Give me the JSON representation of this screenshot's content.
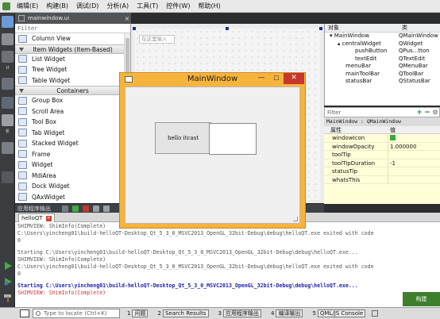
{
  "app": {
    "menu": [
      "编辑(E)",
      "构建(B)",
      "调试(D)",
      "分析(A)",
      "工具(T)",
      "控件(W)",
      "帮助(H)"
    ]
  },
  "modebar": {
    "labels": [
      "计",
      "",
      "",
      "析",
      "",
      "",
      ""
    ]
  },
  "editor_tab": {
    "filename": "mainwindow.ui"
  },
  "widget_box": {
    "filter_placeholder": "Filter",
    "top_items": [
      "Column View"
    ],
    "category_item_based": "Item Widgets (Item-Based)",
    "item_based": [
      "List Widget",
      "Tree Widget",
      "Table Widget"
    ],
    "category_containers": "Containers",
    "containers": [
      "Group Box",
      "Scroll Area",
      "Tool Box",
      "Tab Widget",
      "Stacked Widget",
      "Frame",
      "Widget",
      "MdiArea",
      "Dock Widget",
      "QAxWidget"
    ]
  },
  "design": {
    "type_here": "在这里输入"
  },
  "object_inspector": {
    "col_object": "对象",
    "col_class": "类",
    "rows": [
      {
        "name": "MainWindow",
        "class": "QMainWindow"
      },
      {
        "name": "centralWidget",
        "class": "QWidget"
      },
      {
        "name": "pushButton",
        "class": "QPus...tton"
      },
      {
        "name": "textEdit",
        "class": "QTextEdit"
      },
      {
        "name": "menuBar",
        "class": "QMenuBar"
      },
      {
        "name": "mainToolBar",
        "class": "QToolBar"
      },
      {
        "name": "statusBar",
        "class": "QStatusBar"
      }
    ]
  },
  "property_editor": {
    "filter_placeholder": "Filter",
    "class_path": "MainWindow : QMainWindow",
    "col_property": "属性",
    "col_value": "值",
    "rows": [
      {
        "name": "windowIcon",
        "value": ""
      },
      {
        "name": "windowOpacity",
        "value": "1.000000"
      },
      {
        "name": "toolTip",
        "value": ""
      },
      {
        "name": "toolTipDuration",
        "value": "-1"
      },
      {
        "name": "statusTip",
        "value": ""
      },
      {
        "name": "whatsThis",
        "value": ""
      }
    ]
  },
  "main_window": {
    "title": "MainWindow",
    "button_label": "hello itcast"
  },
  "output": {
    "title": "应用程序输出",
    "tab": "helloQT",
    "lines": [
      {
        "text": "SHIMVIEW: ShimInfo(Complete)",
        "style": "gray"
      },
      {
        "text": "C:\\Users\\yincheng01\\build-helloQT-Desktop_Qt_5_3_0_MSVC2013_OpenGL_32bit-Debug\\debug\\helloQT.exe exited with code",
        "style": "gray"
      },
      {
        "text": "0",
        "style": "gray"
      },
      {
        "text": "",
        "style": "gap"
      },
      {
        "text": "Starting C:\\Users\\yincheng01\\build-helloQT-Desktop_Qt_5_3_0_MSVC2013_OpenGL_32bit-Debug\\debug\\helloQT.exe...",
        "style": "gray"
      },
      {
        "text": "SHIMVIEW: ShimInfo(Complete)",
        "style": "gray"
      },
      {
        "text": "C:\\Users\\yincheng01\\build-helloQT-Desktop_Qt_5_3_0_MSVC2013_OpenGL_32bit-Debug\\debug\\helloQT.exe exited with code",
        "style": "gray"
      },
      {
        "text": "0",
        "style": "gray"
      },
      {
        "text": "",
        "style": "gap"
      },
      {
        "text": "Starting C:\\Users\\yincheng01\\build-helloQT-Desktop_Qt_5_3_0_MSVC2013_OpenGL_32bit-Debug\\debug\\helloQT.exe...",
        "style": "blue"
      },
      {
        "text": "SHIMVIEW: ShimInfo(Complete)",
        "style": "red"
      }
    ]
  },
  "build_widget": {
    "label": "构建"
  },
  "status_bar": {
    "locate_placeholder": "Type to locate (Ctrl+K)",
    "panes": [
      {
        "num": "1",
        "label": "问题"
      },
      {
        "num": "2",
        "label": "Search Results"
      },
      {
        "num": "3",
        "label": "应用程序输出"
      },
      {
        "num": "4",
        "label": "编译输出"
      },
      {
        "num": "5",
        "label": "QML/JS Console"
      }
    ]
  },
  "colors": {
    "dialog_frame": "#f6b43c",
    "close_button": "#c7372b",
    "property_bg": "#ffffd8",
    "output_highlight": "#1a1fa8",
    "output_error": "#c83c3c"
  }
}
